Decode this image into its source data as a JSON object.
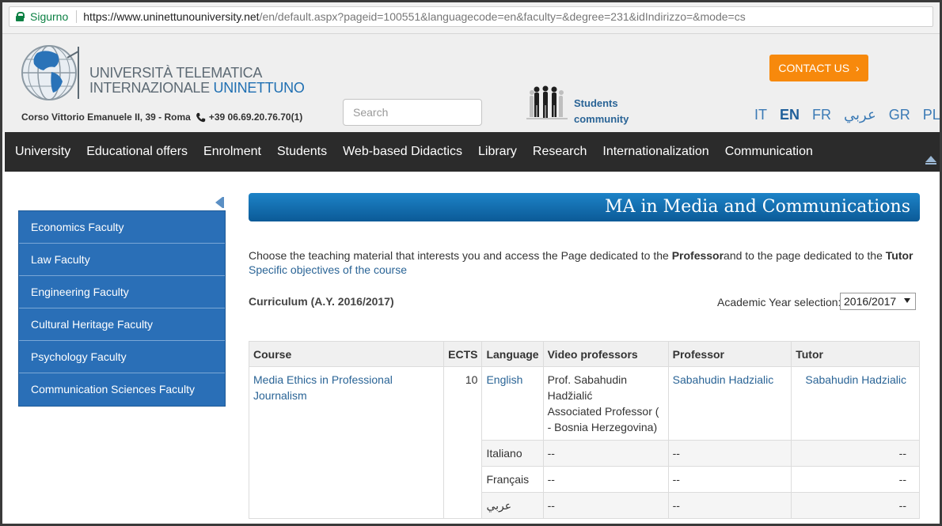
{
  "browser": {
    "secure_label": "Sigurno",
    "url_host": "https://www.uninettunouniversity.net",
    "url_path": "/en/default.aspx?pageid=100551&languagecode=en&faculty=&degree=231&idIndirizzo=&mode=cs"
  },
  "header": {
    "logo_line1": "UNIVERSITÀ TELEMATICA",
    "logo_line2_a": "INTERNAZIONALE ",
    "logo_line2_b": "UNINETTUNO",
    "address": "Corso Vittorio Emanuele II, 39 - Roma",
    "phone": "+39 06.69.20.76.70(1)",
    "search_placeholder": "Search",
    "students_line1": "Students",
    "students_line2": "community",
    "contact_label": "CONTACT US",
    "contact_chevron": "›",
    "languages": [
      "IT",
      "EN",
      "FR",
      "عربي",
      "GR",
      "PL"
    ],
    "active_language": "EN"
  },
  "nav": {
    "items": [
      "University",
      "Educational offers",
      "Enrolment",
      "Students",
      "Web-based Didactics",
      "Library",
      "Research",
      "Internationalization",
      "Communication"
    ]
  },
  "sidebar": {
    "items": [
      "Economics Faculty",
      "Law Faculty",
      "Engineering Faculty",
      "Cultural Heritage Faculty",
      "Psychology Faculty",
      "Communication Sciences Faculty"
    ]
  },
  "main": {
    "title": "MA in Media and Communications",
    "intro_a": "Choose the teaching material that interests you and access the Page dedicated to the ",
    "intro_b": "Professor",
    "intro_c": "and to the page dedicated to the ",
    "intro_d": "Tutor",
    "objectives_link": "Specific objectives of the course",
    "curriculum": "Curriculum (A.Y. 2016/2017)",
    "ay_label": "Academic Year selection:",
    "ay_selected": "2016/2017"
  },
  "table": {
    "headers": [
      "Course",
      "ECTS",
      "Language",
      "Video professors",
      "Professor",
      "Tutor"
    ],
    "course": "Media Ethics in Professional Journalism",
    "ects": "10",
    "rows": [
      {
        "language": "English",
        "video_prof_1": "Prof. Sabahudin Hadžialić",
        "video_prof_2": "Associated Professor ( - Bosnia Herzegovina)",
        "professor": "Sabahudin Hadzialic",
        "tutor": "Sabahudin Hadzialic"
      },
      {
        "language": "Italiano",
        "video_prof": "--",
        "professor": "--",
        "tutor": "--"
      },
      {
        "language": "Français",
        "video_prof": "--",
        "professor": "--",
        "tutor": "--"
      },
      {
        "language": "عربي",
        "video_prof": "--",
        "professor": "--",
        "tutor": "--"
      }
    ]
  }
}
